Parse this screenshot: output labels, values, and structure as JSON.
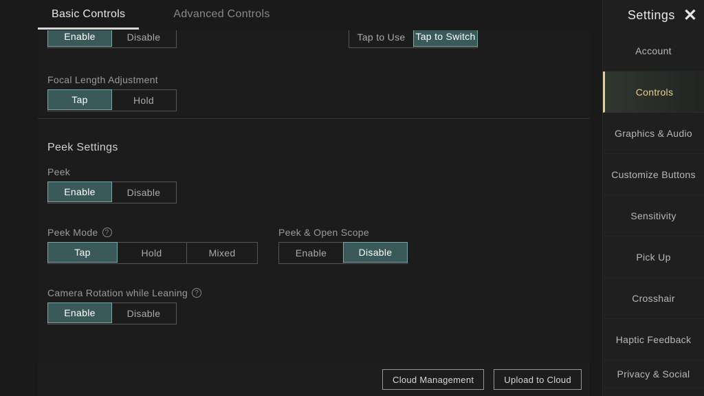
{
  "header": {
    "settings_title": "Settings",
    "close": "✕"
  },
  "tabs": {
    "basic": "Basic Controls",
    "advanced": "Advanced Controls"
  },
  "partial": {
    "enable": "Enable",
    "disable": "Disable",
    "tap_to_use": "Tap to Use",
    "tap_to_switch": "Tap to Switch"
  },
  "focal": {
    "label": "Focal Length Adjustment",
    "tap": "Tap",
    "hold": "Hold"
  },
  "peek_section": "Peek Settings",
  "peek": {
    "label": "Peek",
    "enable": "Enable",
    "disable": "Disable"
  },
  "peek_mode": {
    "label": "Peek Mode",
    "tap": "Tap",
    "hold": "Hold",
    "mixed": "Mixed"
  },
  "peek_scope": {
    "label": "Peek & Open Scope",
    "enable": "Enable",
    "disable": "Disable"
  },
  "camera_lean": {
    "label": "Camera Rotation while Leaning",
    "enable": "Enable",
    "disable": "Disable"
  },
  "bottom": {
    "cloud_mgmt": "Cloud Management",
    "upload": "Upload to Cloud"
  },
  "sidebar": {
    "account": "Account",
    "controls": "Controls",
    "graphics": "Graphics & Audio",
    "customize": "Customize Buttons",
    "sensitivity": "Sensitivity",
    "pickup": "Pick Up",
    "crosshair": "Crosshair",
    "haptic": "Haptic Feedback",
    "privacy": "Privacy & Social"
  }
}
